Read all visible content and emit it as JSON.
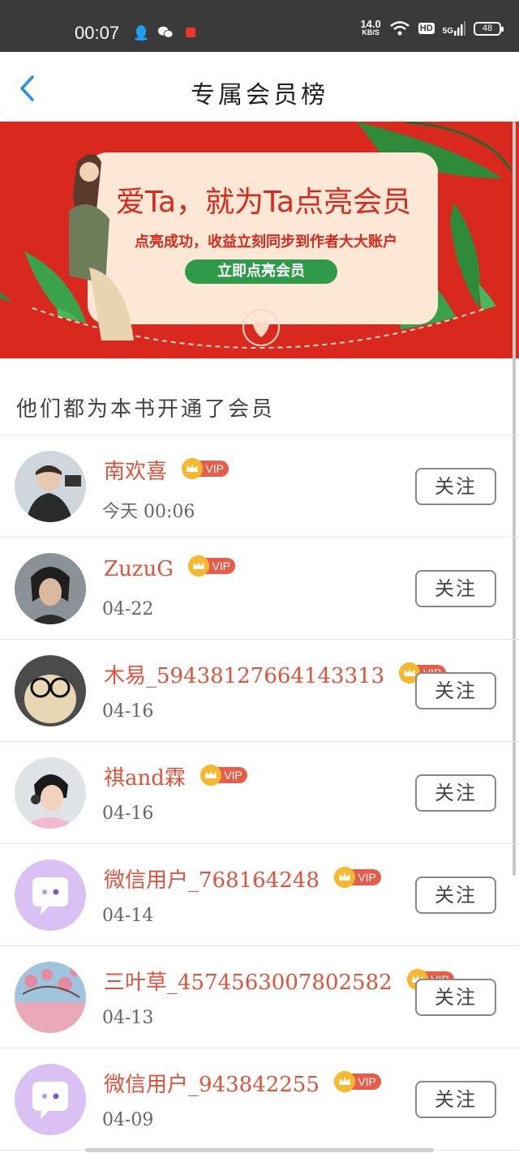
{
  "status_bar": {
    "time": "00:07",
    "net_speed_value": "14.0",
    "net_speed_unit": "KB/S",
    "hd_label": "HD",
    "signal_label": "5G",
    "battery": "48"
  },
  "header": {
    "title": "专属会员榜"
  },
  "banner": {
    "headline": "爱Ta，就为Ta点亮会员",
    "subtext": "点亮成功，收益立刻同步到作者大大账户",
    "button_label": "立即点亮会员"
  },
  "section": {
    "title": "他们都为本书开通了会员"
  },
  "members": [
    {
      "name": "南欢喜",
      "date": "今天 00:06",
      "vip": "VIP",
      "follow": "关注"
    },
    {
      "name": "ZuzuG",
      "date": "04-22",
      "vip": "VIP",
      "follow": "关注"
    },
    {
      "name": "木易_5943812766414331​3",
      "date": "04-16",
      "vip": "VIP",
      "follow": "关注"
    },
    {
      "name": "祺and霖",
      "date": "04-16",
      "vip": "VIP",
      "follow": "关注"
    },
    {
      "name": "微信用户_768164248",
      "date": "04-14",
      "vip": "VIP",
      "follow": "关注"
    },
    {
      "name": "三叶草_4574563007802582",
      "date": "04-13",
      "vip": "VIP",
      "follow": "关注"
    },
    {
      "name": "微信用户_943842255",
      "date": "04-09",
      "vip": "VIP",
      "follow": "关注"
    }
  ],
  "colors": {
    "accent_name": "#e0533a",
    "vip_badge": "#e85d4a",
    "banner_red": "#d9291f",
    "banner_green": "#2f9a4a",
    "back_arrow": "#2b8fe0"
  }
}
